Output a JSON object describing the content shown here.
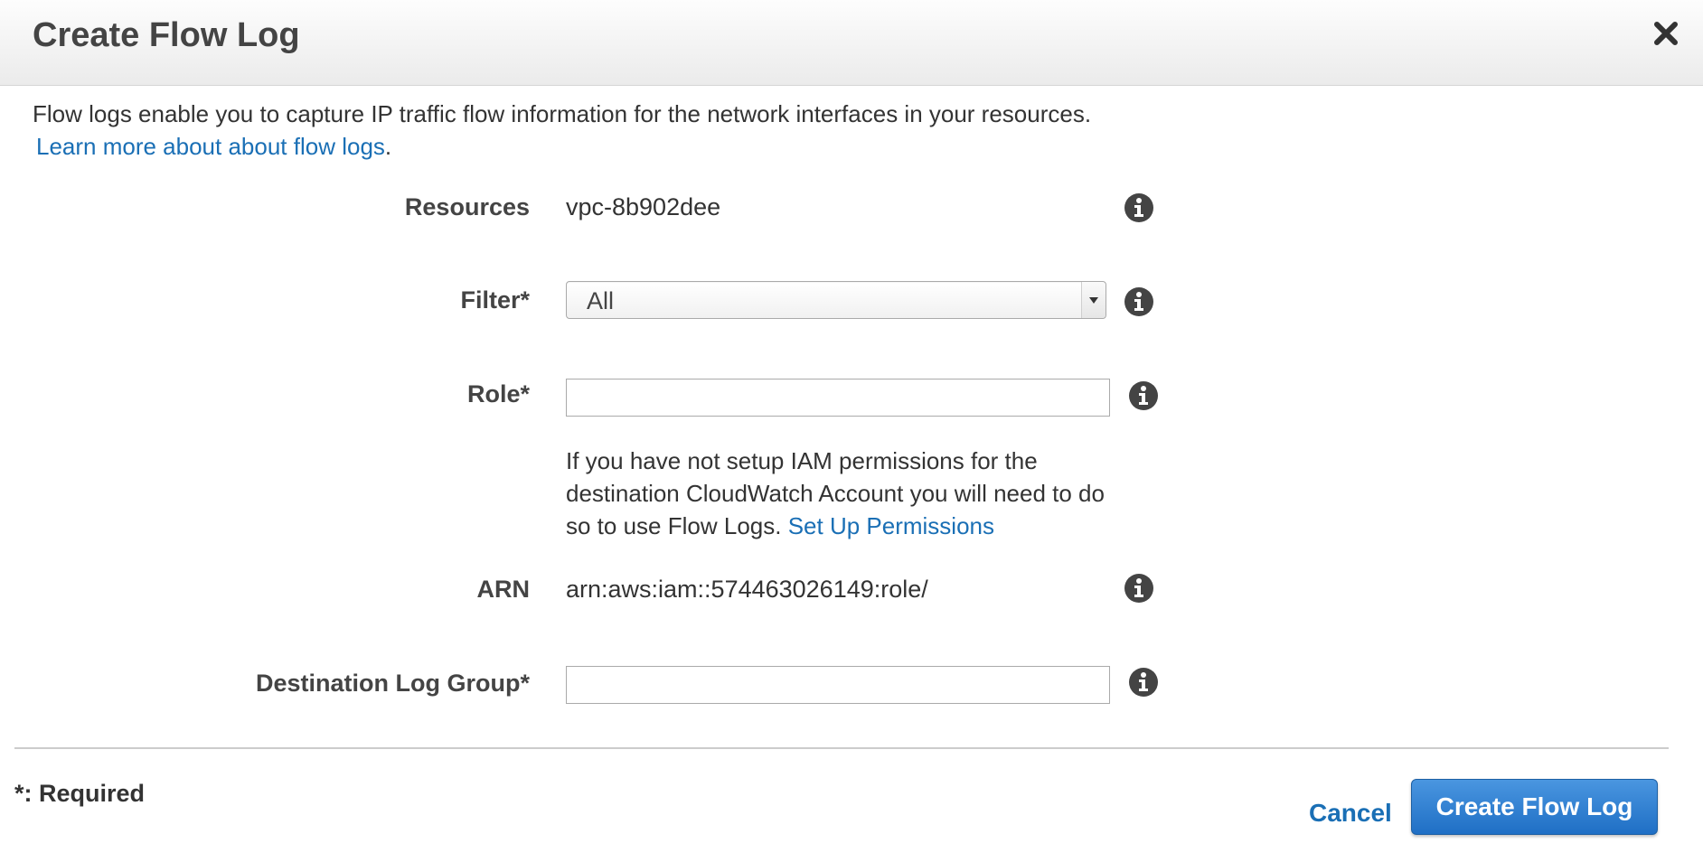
{
  "dialog": {
    "title": "Create Flow Log"
  },
  "intro": {
    "text": "Flow logs enable you to capture IP traffic flow information for the network interfaces in your resources.",
    "link_text": "Learn more about about flow logs",
    "link_suffix": "."
  },
  "form": {
    "resources": {
      "label": "Resources",
      "value": "vpc-8b902dee"
    },
    "filter": {
      "label": "Filter*",
      "selected": "All"
    },
    "role": {
      "label": "Role*",
      "value": "",
      "help_text": "If you have not setup IAM permissions for the destination CloudWatch Account you will need to do so to use Flow Logs.",
      "help_link": "Set Up Permissions"
    },
    "arn": {
      "label": "ARN",
      "value": "arn:aws:iam::574463026149:role/"
    },
    "destination_log_group": {
      "label": "Destination Log Group*",
      "value": ""
    }
  },
  "footer": {
    "required_note": "*: Required",
    "cancel_label": "Cancel",
    "submit_label": "Create Flow Log"
  },
  "colors": {
    "link": "#1a6fb5",
    "primary_button": "#2a7acc",
    "info_icon": "#444444"
  },
  "icons": {
    "close": "close-icon",
    "info": "info-icon",
    "dropdown": "chevron-down-icon"
  }
}
